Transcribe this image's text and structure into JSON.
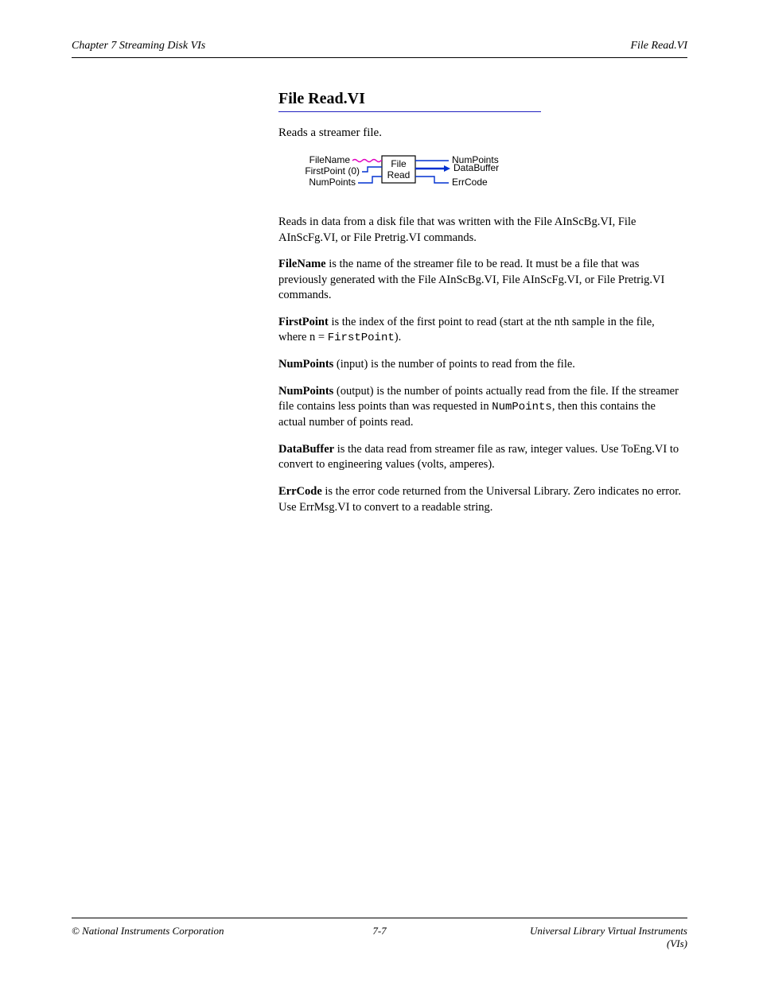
{
  "header": {
    "left": "Chapter 7      Streaming Disk VIs",
    "right": "File Read.VI"
  },
  "section": {
    "title": "File Read.VI",
    "subtitle": "Reads a streamer file."
  },
  "diagram": {
    "inputs": [
      {
        "label": "FileName",
        "y": 12,
        "style": "string"
      },
      {
        "label": "FirstPoint (0)",
        "y": 26,
        "style": "int"
      },
      {
        "label": "NumPoints",
        "y": 40,
        "style": "int"
      }
    ],
    "block": {
      "top": "File",
      "bottom": "Read"
    },
    "outputs": [
      {
        "label": "NumPoints",
        "y": 12,
        "style": "int"
      },
      {
        "label": "DataBuffer",
        "y": 26,
        "style": "array"
      },
      {
        "label": "ErrCode",
        "y": 40,
        "style": "int"
      }
    ]
  },
  "body": {
    "p1": "Reads in data from a disk file that was written with the File AInScBg.VI, File AInScFg.VI, or File Pretrig.VI commands.",
    "p2a": "FileName",
    "p2b": " is the name of the streamer file to be read. It must be a file that was previously generated with the File AInScBg.VI, File AInScFg.VI, or File Pretrig.VI commands.",
    "p3a": "FirstPoint",
    "p3b": " is the index of the first point to read (start at the nth sample in the file, where n = ",
    "p3c": "FirstPoint",
    "p3d": ").",
    "p4a": "NumPoints",
    "p4b": " (input) is the number of points to read from the file.",
    "p5a": "NumPoints",
    "p5b": " (output) is the number of points actually read from the file. If the streamer file contains less points than was requested in ",
    "p5c": "NumPoints",
    "p5d": ", then this contains the actual number of points read.",
    "p6a": "DataBuffer",
    "p6b": " is the data read from streamer file as raw, integer values. Use ToEng.VI to convert to engineering values (volts, amperes).",
    "p7a": "ErrCode",
    "p7b": " is the error code returned from the Universal Library. Zero indicates no error. Use ErrMsg.VI to convert to a readable string."
  },
  "footer": {
    "left": "© National Instruments Corporation",
    "center": "7-7",
    "right": "Universal Library Virtual Instruments (VIs)"
  }
}
